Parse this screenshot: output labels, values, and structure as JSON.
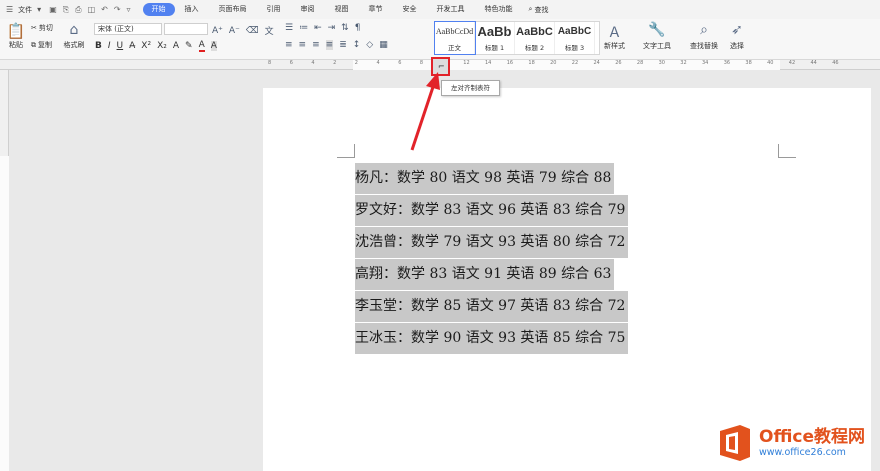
{
  "menubar": {
    "file_label": "文件",
    "tabs": [
      "开始",
      "插入",
      "页面布局",
      "引用",
      "审阅",
      "视图",
      "章节",
      "安全",
      "开发工具",
      "特色功能"
    ],
    "active_tab": "开始",
    "search_label": "查找"
  },
  "ribbon": {
    "paste_label": "粘贴",
    "cut_label": "剪切",
    "copy_label": "复制",
    "format_painter_label": "格式刷",
    "font_name": "宋体 (正文)",
    "font_size": "",
    "styles": [
      {
        "preview": "AaBbCcDd",
        "label": "正文"
      },
      {
        "preview": "AaBb",
        "label": "标题 1"
      },
      {
        "preview": "AaBbC",
        "label": "标题 2"
      },
      {
        "preview": "AaBbC",
        "label": "标题 3"
      }
    ],
    "new_style_label": "新样式",
    "text_tools_label": "文字工具",
    "find_replace_label": "查找替换",
    "select_label": "选择"
  },
  "ruler": {
    "numbers": [
      "8",
      "6",
      "4",
      "2",
      "2",
      "4",
      "6",
      "8",
      "10",
      "12",
      "14",
      "16",
      "18",
      "20",
      "22",
      "24",
      "26",
      "28",
      "30",
      "32",
      "34",
      "36",
      "38",
      "40",
      "42",
      "44",
      "46"
    ]
  },
  "tooltip": {
    "text": "左对齐制表符"
  },
  "document": {
    "lines": [
      "杨凡：数学 80 语文 98 英语 79 综合 88",
      "罗文好：数学 83 语文 96 英语 83 综合 79",
      "沈浩曾：数学 79 语文 93 英语 80 综合 72",
      "高翔：数学 83 语文 91 英语 89 综合 63",
      "李玉堂：数学 85 语文 97 英语 83 综合 72",
      "王冰玉：数学 90 语文 93 英语 85 综合 75"
    ]
  },
  "watermark": {
    "title": "Office教程网",
    "url": "www.office26.com"
  },
  "colors": {
    "accent": "#5181f0",
    "highlight": "#c8c8c8",
    "callout": "#e2232a",
    "brand": "#e2521d"
  }
}
